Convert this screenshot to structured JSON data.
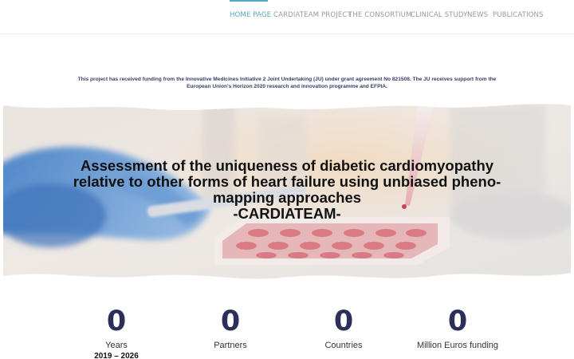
{
  "nav": {
    "items": [
      {
        "label": "HOME PAGE",
        "active": true
      },
      {
        "label": "CARDIATEAM PROJECT",
        "active": false
      },
      {
        "label": "THE CONSORTIUM",
        "active": false
      },
      {
        "label": "CLINICAL STUDY",
        "active": false
      },
      {
        "label": "NEWS",
        "active": false
      },
      {
        "label": "PUBLICATIONS",
        "active": false
      }
    ]
  },
  "funding": {
    "line1": "This project has received funding from the Innovative Medicines Initiative 2 Joint Undertaking (JU) under grant agreement No 821508. The JU receives support from the",
    "line2": "European Union's Horizon 2020 research and innovation programme and EFPIA."
  },
  "hero": {
    "title_lines": [
      "Assessment of the uniqueness of diabetic cardiomyopathy",
      "relative to other forms of heart failure using unbiased pheno-",
      "mapping approaches",
      "-CARDIATEAM-"
    ]
  },
  "stats": [
    {
      "value": "0",
      "label": "Years",
      "sub": "2019 – 2026"
    },
    {
      "value": "0",
      "label": "Partners",
      "sub": ""
    },
    {
      "value": "0",
      "label": "Countries",
      "sub": ""
    },
    {
      "value": "0",
      "label": "Million Euros funding",
      "sub": ""
    }
  ],
  "colors": {
    "accent": "#55a6c9",
    "nav_text": "#9a9a9a",
    "stat_number": "#2b2f5a",
    "funding_text": "#3a3d6b"
  }
}
